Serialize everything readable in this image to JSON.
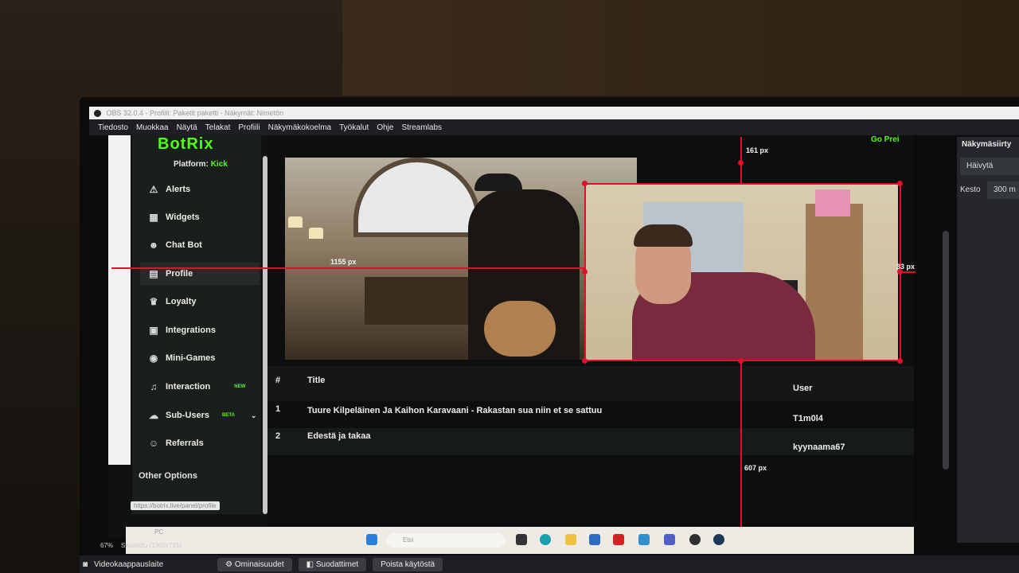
{
  "obs": {
    "title": "OBS 32.0.4 - Profiili: Paketit paketti - Näkymät: Nimetön",
    "menu": [
      "Tiedosto",
      "Muokkaa",
      "Näytä",
      "Telakat",
      "Profiili",
      "Näkymäkokoelma",
      "Työkalut",
      "Ohje",
      "Streamlabs"
    ],
    "status_zoom": "67%",
    "status_scaled": "Skaalattu (1300x731)",
    "dock": {
      "title": "Näkymäsiirty",
      "transition": "Häivytä",
      "duration_label": "Kesto",
      "duration_value": "300 m"
    },
    "bottom": {
      "source_name": "Videokaappauslaite",
      "properties": "Ominaisuudet",
      "filters": "Suodattimet",
      "remove": "Poista käytöstä"
    }
  },
  "botrix": {
    "logo": "BotRix",
    "platform_label": "Platform:",
    "platform_value": "Kick",
    "go_premium": "Go Prei",
    "nav": [
      {
        "label": "Alerts",
        "icon": "⚠"
      },
      {
        "label": "Widgets",
        "icon": "▦"
      },
      {
        "label": "Chat Bot",
        "icon": "☻"
      },
      {
        "label": "Profile",
        "icon": "▤"
      },
      {
        "label": "Loyalty",
        "icon": "♛"
      },
      {
        "label": "Integrations",
        "icon": "▣"
      },
      {
        "label": "Mini-Games",
        "icon": "◉"
      },
      {
        "label": "Interaction",
        "icon": "♫",
        "tag": "NEW"
      },
      {
        "label": "Sub-Users",
        "icon": "☁",
        "tag": "BETA"
      },
      {
        "label": "Referrals",
        "icon": "☺"
      }
    ],
    "other_options": "Other Options",
    "status_url": "https://botrix.live/panel/profile",
    "table": {
      "headers": {
        "num": "#",
        "title": "Title",
        "user": "User"
      },
      "rows": [
        {
          "num": "1",
          "title": "Tuure Kilpeläinen Ja Kaihon Karavaani - Rakastan sua niin et se sattuu",
          "user": "T1m0l4"
        },
        {
          "num": "2",
          "title": "Edestä ja takaa",
          "user": "kyynaama67"
        }
      ]
    }
  },
  "guides": {
    "top": "161 px",
    "left": "1155 px",
    "right": "33 px",
    "bottom": "607 px"
  },
  "taskbar": {
    "search_placeholder": "Etsi",
    "pc_label": "PC"
  }
}
